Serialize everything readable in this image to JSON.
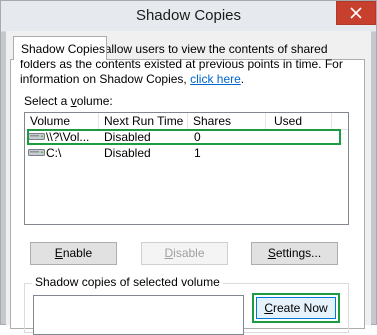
{
  "window": {
    "title": "Shadow Copies"
  },
  "tab": {
    "label": "Shadow Copies"
  },
  "description": {
    "text": "Shadow copies allow users to view the contents of shared folders as the contents existed at previous points in time. For information on Shadow Copies,",
    "link": "click here",
    "end": "."
  },
  "volume_section": {
    "label_pre": "Select a ",
    "label_accel": "v",
    "label_post": "olume:"
  },
  "table": {
    "columns": [
      "Volume",
      "Next Run Time",
      "Shares",
      "Used"
    ],
    "rows": [
      {
        "volume": "\\\\?\\Vol...",
        "next_run": "Disabled",
        "shares": "0",
        "used": ""
      },
      {
        "volume": "C:\\",
        "next_run": "Disabled",
        "shares": "1",
        "used": ""
      }
    ]
  },
  "buttons": {
    "enable_accel": "E",
    "enable_rest": "nable",
    "disable_accel": "D",
    "disable_rest": "isable",
    "settings_accel": "S",
    "settings_rest": "ettings...",
    "create_now_accel": "C",
    "create_now_rest": "reate Now"
  },
  "copies_group": {
    "label": "Shadow copies of selected volume"
  },
  "icons": {
    "close": "close-icon",
    "drive": "drive-icon"
  },
  "colors": {
    "highlight_outline": "#1d9b43",
    "close_button": "#c7402e",
    "link": "#0066cc"
  }
}
